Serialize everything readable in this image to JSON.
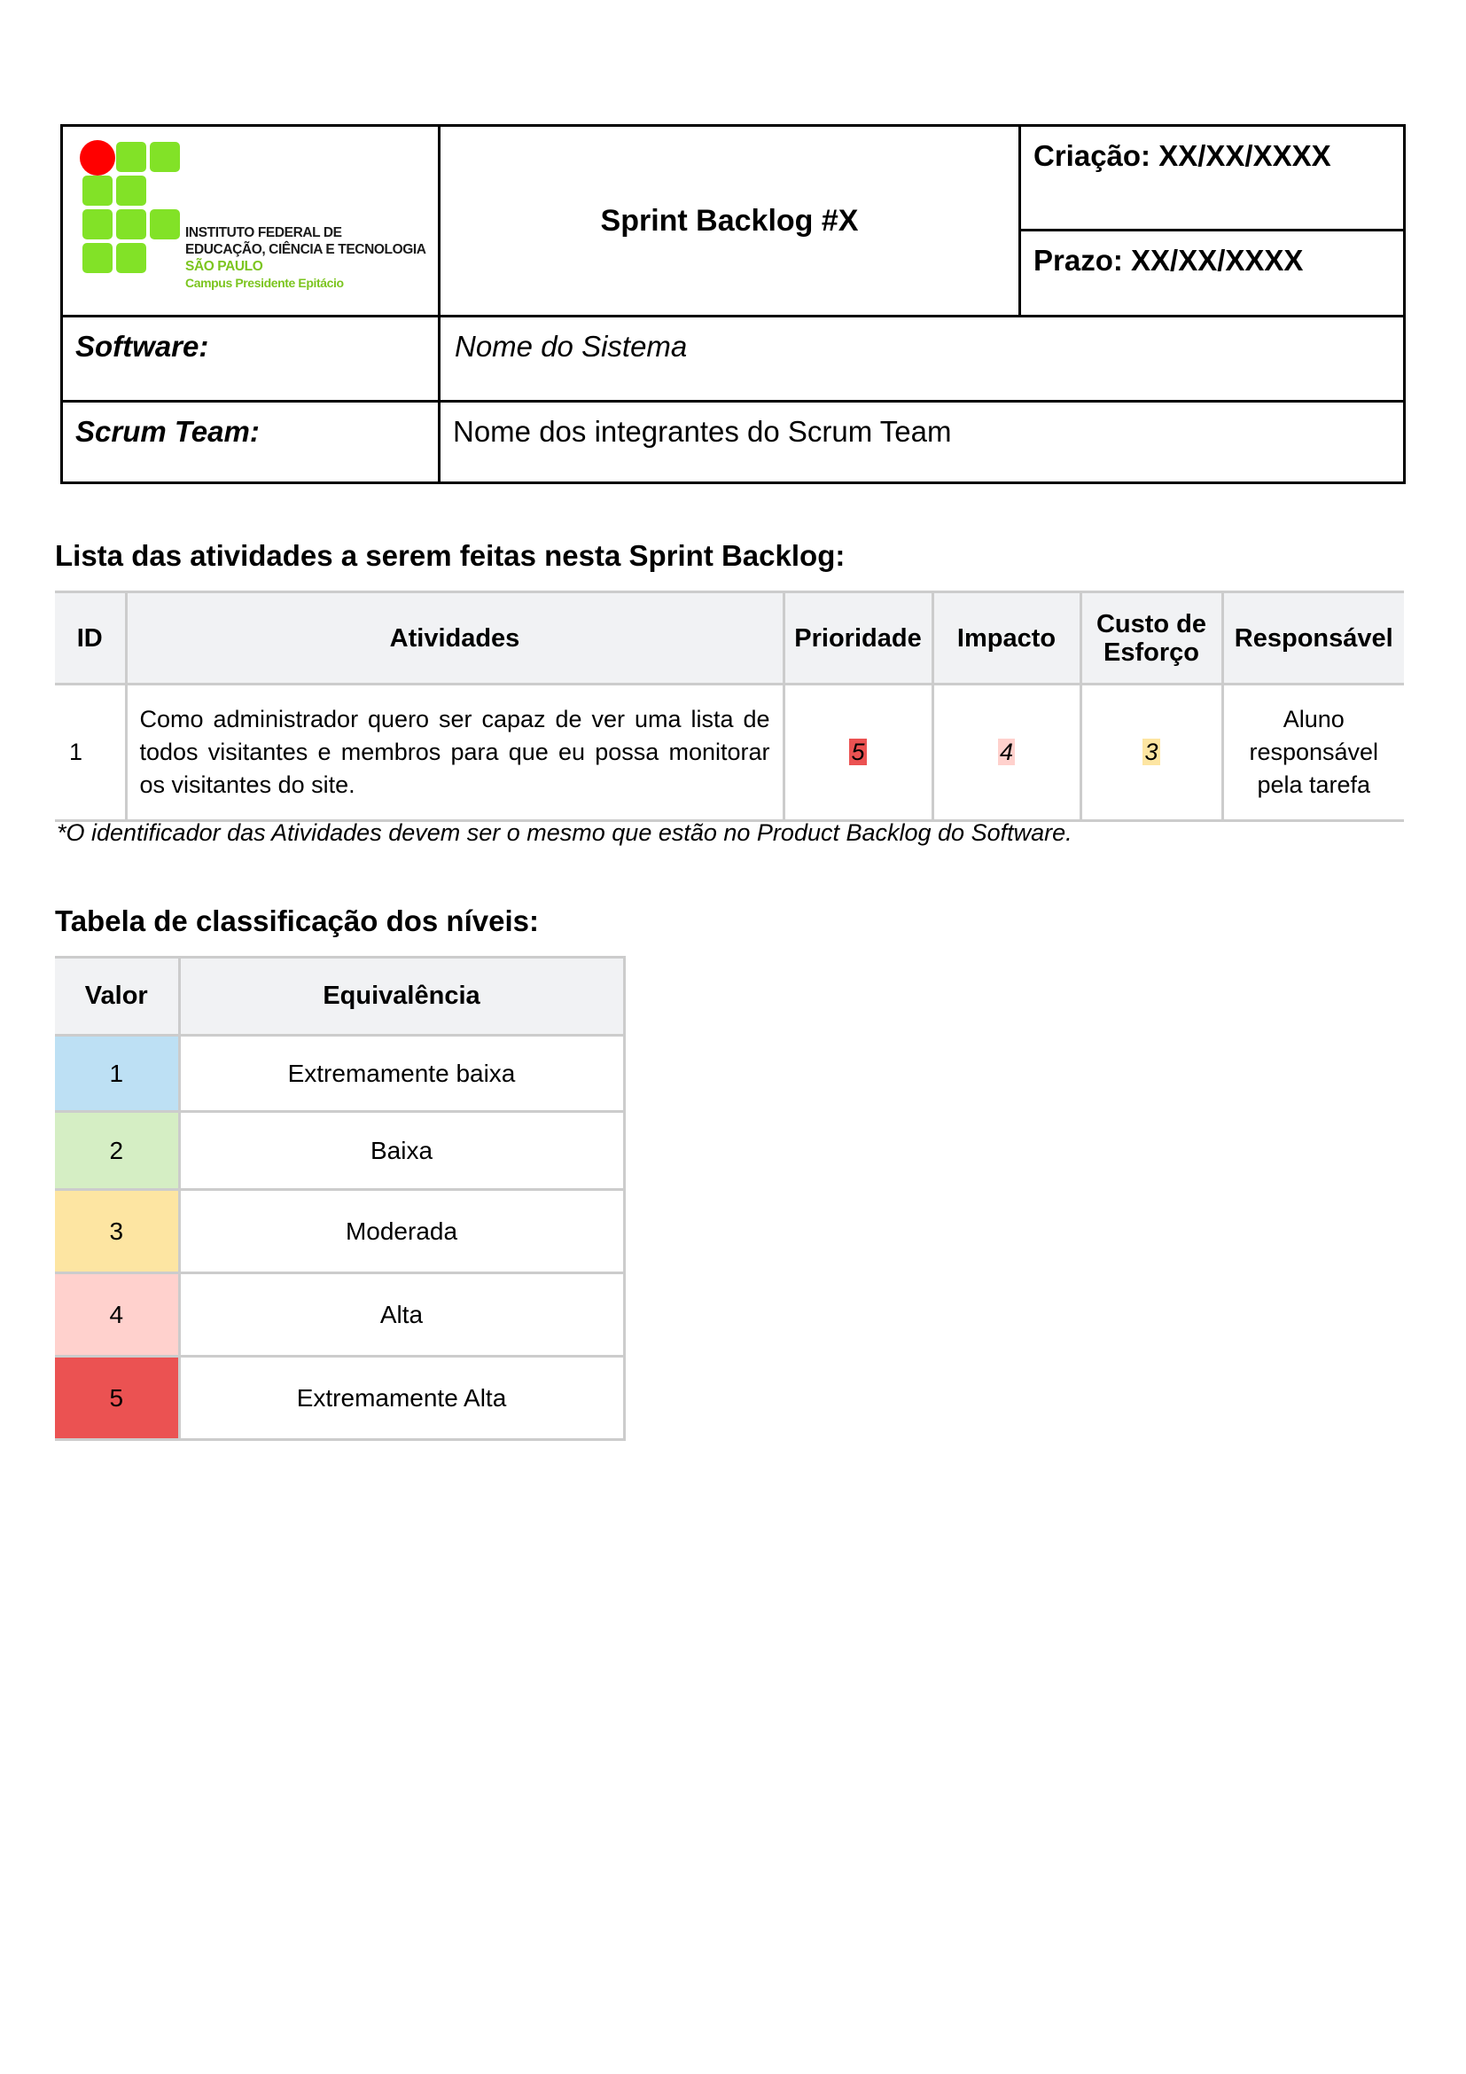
{
  "header": {
    "institution_lines": [
      "INSTITUTO FEDERAL DE",
      "EDUCAÇÃO, CIÊNCIA E TECNOLOGIA",
      "SÃO PAULO",
      "Campus Presidente Epitácio"
    ],
    "title": "Sprint Backlog #X",
    "criacao": "Criação: XX/XX/XXXX",
    "prazo": "Prazo: XX/XX/XXXX",
    "software_label": "Software:",
    "software_value": "Nome do Sistema",
    "team_label": "Scrum Team:",
    "team_value": "Nome dos integrantes do Scrum Team"
  },
  "activities": {
    "section_title": "Lista das atividades a serem feitas nesta Sprint Backlog:",
    "columns": [
      "ID",
      "Atividades",
      "Prioridade",
      "Impacto",
      "Custo de Esforço",
      "Responsável"
    ],
    "rows": [
      {
        "id": "1",
        "atividade": "Como administrador quero ser capaz de ver uma lista de todos visitantes e membros para que eu possa monitorar os visitantes do site.",
        "prioridade": "5",
        "impacto": "4",
        "custo": "3",
        "responsavel": "Aluno responsável pela tarefa"
      }
    ],
    "footnote": "*O identificador das Atividades devem ser o mesmo que estão no Product Backlog do Software."
  },
  "levels": {
    "section_title": "Tabela de classificação dos níveis:",
    "columns": [
      "Valor",
      "Equivalência"
    ],
    "rows": [
      {
        "valor": "1",
        "equivalencia": "Extremamente baixa",
        "color": "#bde0f4"
      },
      {
        "valor": "2",
        "equivalencia": "Baixa",
        "color": "#d5eec4"
      },
      {
        "valor": "3",
        "equivalencia": "Moderada",
        "color": "#fde5a2"
      },
      {
        "valor": "4",
        "equivalencia": "Alta",
        "color": "#ffd1cd"
      },
      {
        "valor": "5",
        "equivalencia": "Extremamente Alta",
        "color": "#eb5252"
      }
    ]
  }
}
